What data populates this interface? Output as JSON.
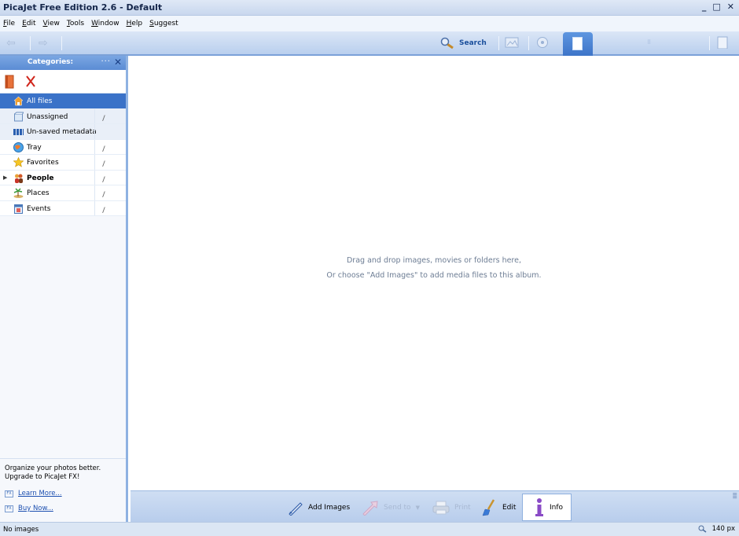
{
  "window": {
    "title": "PicaJet Free Edition 2.6  - Default",
    "controls": {
      "minimize": "_",
      "maximize": "□",
      "close": "✕"
    }
  },
  "menu": [
    "File",
    "Edit",
    "View",
    "Tools",
    "Window",
    "Help",
    "Suggest"
  ],
  "toolbar": {
    "back_icon": "back-arrow-icon",
    "forward_icon": "forward-arrow-icon",
    "search_label": "Search"
  },
  "sidebar": {
    "header": "Categories:",
    "header_dots": "···",
    "header_close": "✕",
    "categories": [
      {
        "label": "All files",
        "icon": "house-icon"
      },
      {
        "label": "Unassigned",
        "icon": "box-icon"
      },
      {
        "label": "Un-saved metadata",
        "icon": "bars-icon"
      },
      {
        "label": "Tray",
        "icon": "globe-icon"
      },
      {
        "label": "Favorites",
        "icon": "star-icon"
      },
      {
        "label": "People",
        "icon": "people-icon"
      },
      {
        "label": "Places",
        "icon": "island-icon"
      },
      {
        "label": "Events",
        "icon": "calendar-icon"
      }
    ],
    "promo": {
      "line1": "Organize your photos better.",
      "line2": "Upgrade to PicaJet FX!",
      "fx_tag": "FX",
      "learn_more": "Learn More...",
      "buy_now": "Buy Now..."
    }
  },
  "main": {
    "hint_line1": "Drag and drop images, movies or folders here,",
    "hint_line2": "Or choose \"Add Images\" to add media files to this album."
  },
  "actions": {
    "add_images": "Add Images",
    "send_to": "Send to",
    "print": "Print",
    "edit": "Edit",
    "info": "Info"
  },
  "status": {
    "left": "No images",
    "zoom": "140 px"
  },
  "colors": {
    "accent": "#3a72c8",
    "selected_row": "#3a72c8",
    "link": "#1c4fb0"
  }
}
